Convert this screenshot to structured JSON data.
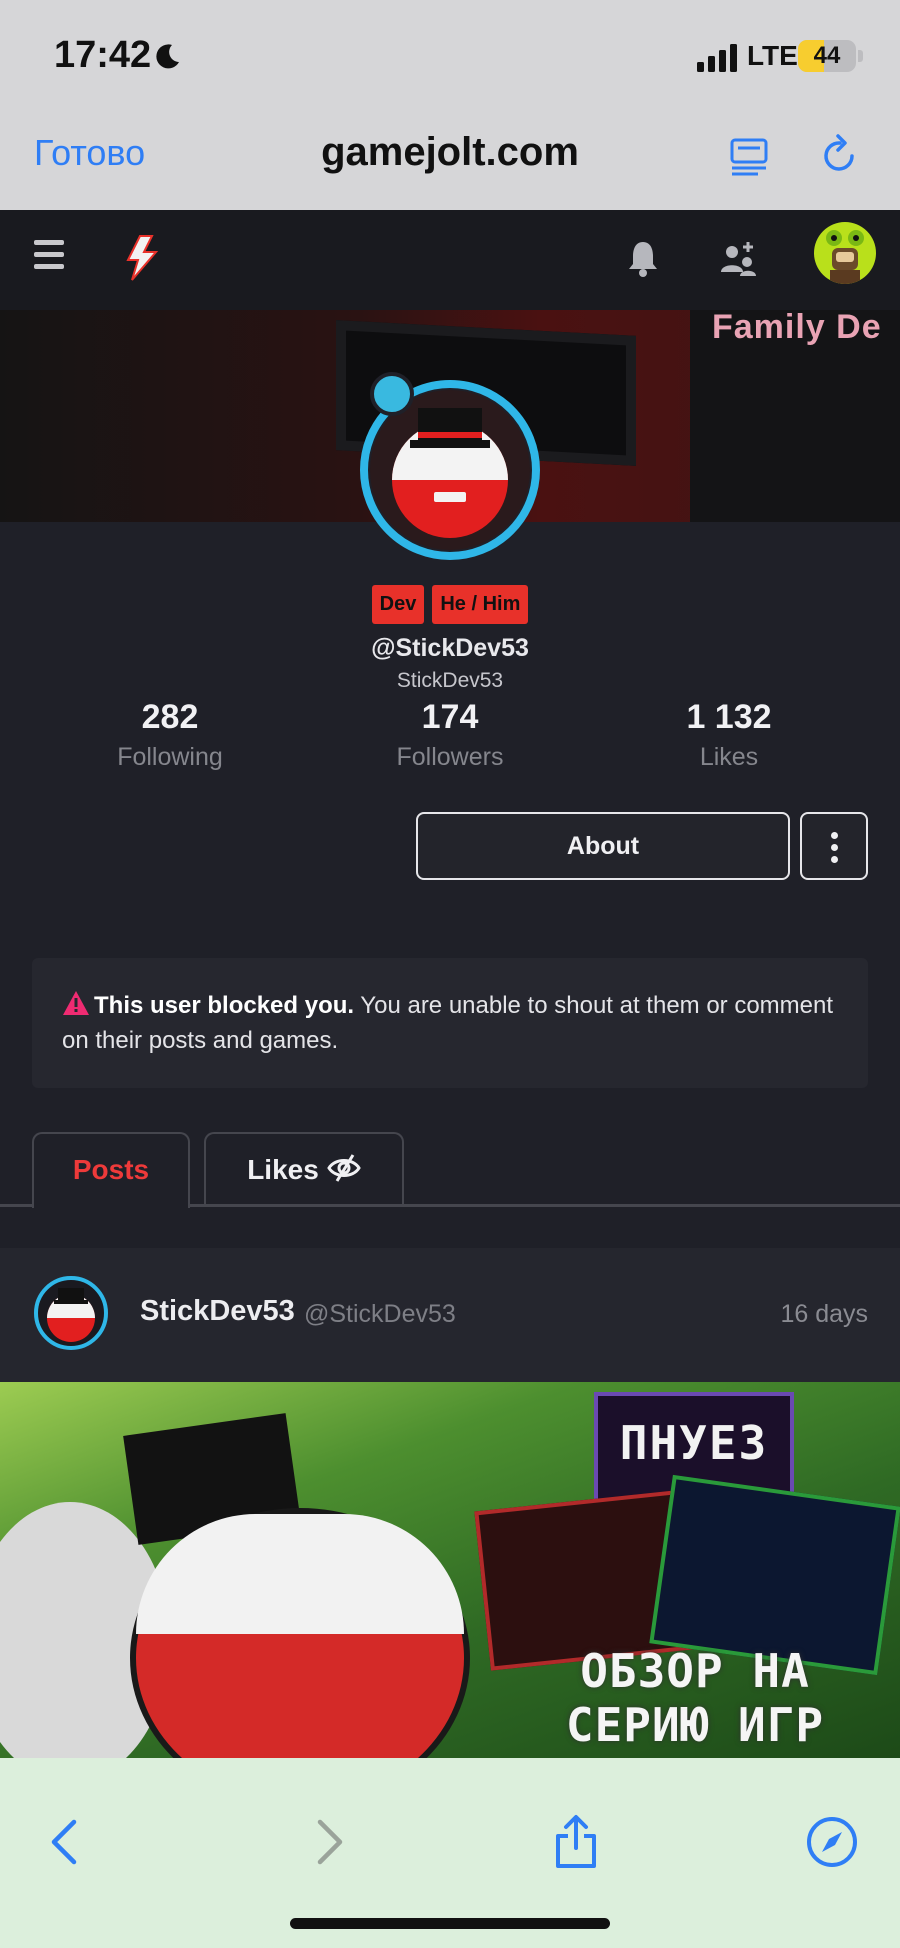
{
  "status_bar": {
    "time": "17:42",
    "network": "LTE",
    "battery": "44",
    "battery_level": 0.44
  },
  "safari": {
    "done_label": "Готово",
    "domain": "gamejolt.com"
  },
  "profile": {
    "tags": [
      "Dev",
      "He / Him"
    ],
    "handle": "@StickDev53",
    "display_name": "StickDev53",
    "stats": [
      {
        "value": "282",
        "label": "Following"
      },
      {
        "value": "174",
        "label": "Followers"
      },
      {
        "value": "1 132",
        "label": "Likes"
      }
    ],
    "about_label": "About",
    "banner_text": "Family De"
  },
  "blocked_notice": {
    "bold": "This user blocked you.",
    "text": " You are unable to shout at them or comment on their posts and games."
  },
  "tabs": [
    {
      "label": "Posts",
      "active": true
    },
    {
      "label": "Likes",
      "active": false
    }
  ],
  "post": {
    "author": "StickDev53",
    "handle": "@StickDev53",
    "time": "16 days",
    "image_title": "ПНУЕЗ",
    "image_text": "ОБЗОР НА СЕРИЮ ИГР"
  },
  "colors": {
    "accent_blue": "#2f7ef5",
    "tag_red": "#e8312a",
    "active_tab": "#ee3a3a",
    "avatar_ring": "#2fb7e8"
  }
}
